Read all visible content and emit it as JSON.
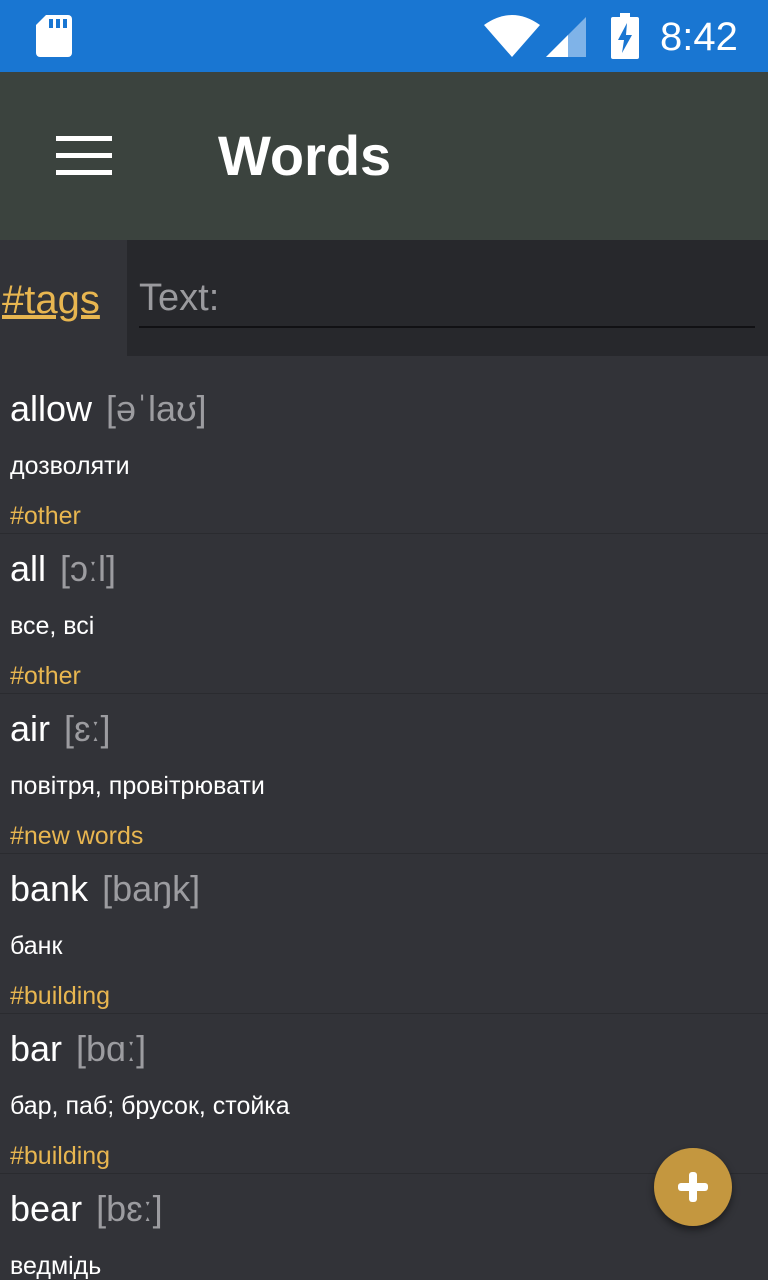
{
  "status_bar": {
    "time": "8:42",
    "icons": [
      "sd-card-icon",
      "wifi-icon",
      "cell-signal-icon",
      "battery-charging-icon"
    ]
  },
  "app_bar": {
    "title": "Words",
    "menu_icon": "hamburger-menu-icon"
  },
  "filter": {
    "tags_label": "#tags",
    "text_placeholder": "Text:"
  },
  "words": [
    {
      "word": "allow",
      "ipa": "[əˈlaʊ]",
      "translation": "дозволяти",
      "tag": "#other"
    },
    {
      "word": "all",
      "ipa": "[ɔːl]",
      "translation": "все, всі",
      "tag": "#other"
    },
    {
      "word": "air",
      "ipa": "[ɛː]",
      "translation": "повітря, провітрювати",
      "tag": "#new words"
    },
    {
      "word": "bank",
      "ipa": "[baŋk]",
      "translation": "банк",
      "tag": "#building"
    },
    {
      "word": "bar",
      "ipa": "[bɑː]",
      "translation": "бар, паб; брусок, стойка",
      "tag": "#building"
    },
    {
      "word": "bear",
      "ipa": "[bɛː]",
      "translation": "ведмідь",
      "tag": ""
    }
  ],
  "fab": {
    "icon": "plus-icon"
  },
  "colors": {
    "status_bar": "#1976d2",
    "app_bar": "#3b433e",
    "background": "#323338",
    "accent": "#e8b650",
    "fab": "#c4973f"
  }
}
